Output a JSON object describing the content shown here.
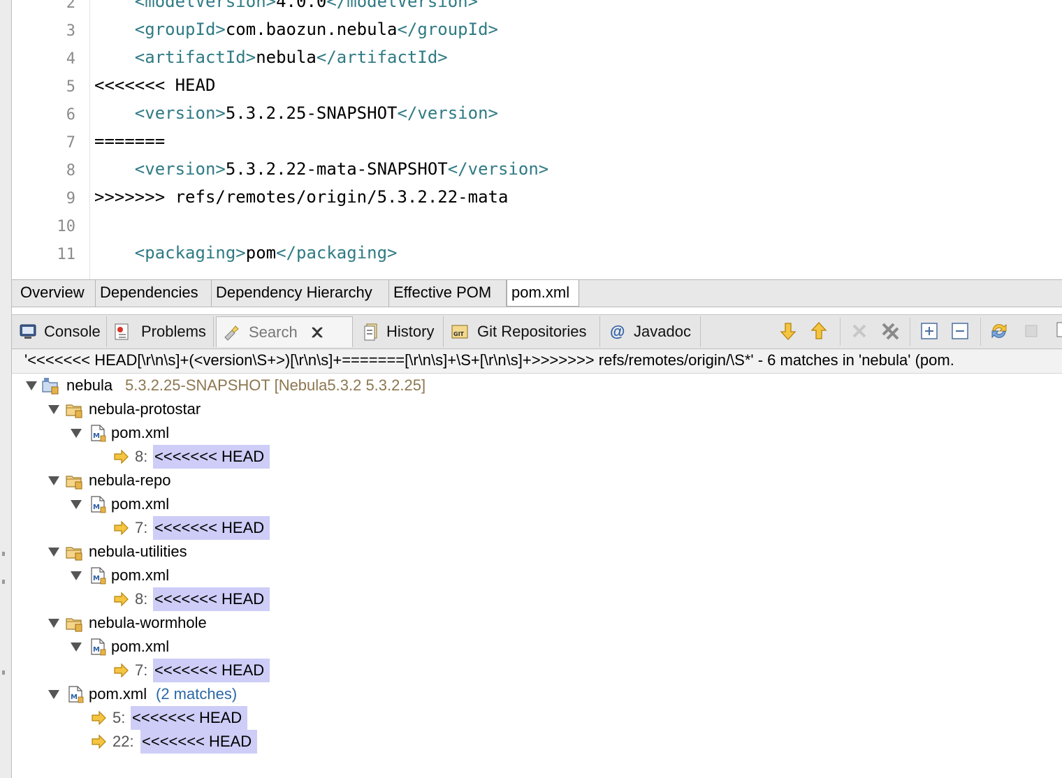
{
  "editor": {
    "lines": [
      {
        "num": "2",
        "segments": [
          {
            "t": "    ",
            "c": ""
          },
          {
            "t": "<modelVersion>",
            "c": "tag"
          },
          {
            "t": "4.0.0",
            "c": ""
          },
          {
            "t": "</modelVersion>",
            "c": "tag"
          }
        ]
      },
      {
        "num": "3",
        "segments": [
          {
            "t": "    ",
            "c": ""
          },
          {
            "t": "<groupId>",
            "c": "tag"
          },
          {
            "t": "com.baozun.nebula",
            "c": ""
          },
          {
            "t": "</groupId>",
            "c": "tag"
          }
        ]
      },
      {
        "num": "4",
        "segments": [
          {
            "t": "    ",
            "c": ""
          },
          {
            "t": "<artifactId>",
            "c": "tag"
          },
          {
            "t": "nebula",
            "c": ""
          },
          {
            "t": "</artifactId>",
            "c": "tag"
          }
        ]
      },
      {
        "num": "5",
        "segments": [
          {
            "t": "<<<<<<< HEAD",
            "c": ""
          }
        ]
      },
      {
        "num": "6",
        "segments": [
          {
            "t": "    ",
            "c": ""
          },
          {
            "t": "<version>",
            "c": "tag"
          },
          {
            "t": "5.3.2.25-SNAPSHOT",
            "c": ""
          },
          {
            "t": "</version>",
            "c": "tag"
          }
        ]
      },
      {
        "num": "7",
        "segments": [
          {
            "t": "=======",
            "c": ""
          }
        ]
      },
      {
        "num": "8",
        "segments": [
          {
            "t": "    ",
            "c": ""
          },
          {
            "t": "<version>",
            "c": "tag"
          },
          {
            "t": "5.3.2.22-mata-SNAPSHOT",
            "c": ""
          },
          {
            "t": "</version>",
            "c": "tag"
          }
        ]
      },
      {
        "num": "9",
        "segments": [
          {
            "t": ">>>>>>> refs/remotes/origin/5.3.2.22-mata",
            "c": ""
          }
        ]
      },
      {
        "num": "10",
        "segments": [
          {
            "t": "",
            "c": ""
          }
        ]
      },
      {
        "num": "11",
        "segments": [
          {
            "t": "    ",
            "c": ""
          },
          {
            "t": "<packaging>",
            "c": "tag"
          },
          {
            "t": "pom",
            "c": ""
          },
          {
            "t": "</packaging>",
            "c": "tag"
          }
        ]
      }
    ]
  },
  "editor_tabs": [
    "Overview",
    "Dependencies",
    "Dependency Hierarchy",
    "Effective POM",
    "pom.xml"
  ],
  "view_tabs": {
    "console": "Console",
    "problems": "Problems",
    "search": "Search",
    "history": "History",
    "git": "Git Repositories",
    "javadoc": "Javadoc"
  },
  "summary": "'<<<<<<< HEAD[\\r\\n\\s]+(<version\\S+>)[\\r\\n\\s]+=======[\\r\\n\\s]+\\S+[\\r\\n\\s]+>>>>>>> refs/remotes/origin/\\S*' - 6 matches in 'nebula' (pom.",
  "tree": {
    "root_name": "nebula",
    "root_detail": "5.3.2.25-SNAPSHOT [Nebula5.3.2 5.3.2.25]",
    "modules": [
      {
        "name": "nebula-protostar",
        "file": "pom.xml",
        "line": "8:",
        "match": "<<<<<<< HEAD"
      },
      {
        "name": "nebula-repo",
        "file": "pom.xml",
        "line": "7:",
        "match": "<<<<<<< HEAD"
      },
      {
        "name": "nebula-utilities",
        "file": "pom.xml",
        "line": "8:",
        "match": "<<<<<<< HEAD"
      },
      {
        "name": "nebula-wormhole",
        "file": "pom.xml",
        "line": "7:",
        "match": "<<<<<<< HEAD"
      }
    ],
    "root_file": "pom.xml",
    "root_file_count": "(2 matches)",
    "root_matches": [
      {
        "line": "5:",
        "match": "<<<<<<< HEAD"
      },
      {
        "line": "22:",
        "match": "<<<<<<< HEAD"
      }
    ]
  }
}
